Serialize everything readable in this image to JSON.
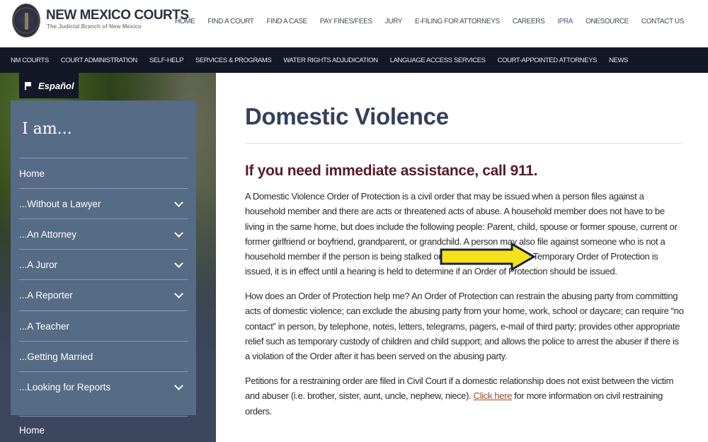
{
  "header": {
    "brand_title": "NEW MEXICO COURTS",
    "brand_subtitle": "The Judicial Branch of New Mexico",
    "top_nav": [
      {
        "label": "HOME"
      },
      {
        "label": "FIND A COURT"
      },
      {
        "label": "FIND A CASE"
      },
      {
        "label": "PAY FINES/FEES"
      },
      {
        "label": "JURY"
      },
      {
        "label": "E-FILING FOR ATTORNEYS"
      },
      {
        "label": "CAREERS"
      },
      {
        "label": "IPRA"
      },
      {
        "label": "ONESOURCE"
      },
      {
        "label": "CONTACT US"
      }
    ]
  },
  "main_nav": [
    {
      "label": "NM COURTS"
    },
    {
      "label": "COURT ADMINISTRATION"
    },
    {
      "label": "SELF-HELP"
    },
    {
      "label": "SERVICES & PROGRAMS"
    },
    {
      "label": "WATER RIGHTS ADJUDICATION"
    },
    {
      "label": "LANGUAGE ACCESS SERVICES"
    },
    {
      "label": "COURT-APPOINTED ATTORNEYS"
    },
    {
      "label": "NEWS"
    }
  ],
  "sidebar": {
    "language_label": "Español",
    "title": "I am...",
    "items": [
      {
        "label": "Home",
        "expandable": false
      },
      {
        "label": "...Without a Lawyer",
        "expandable": true
      },
      {
        "label": "...An Attorney",
        "expandable": true
      },
      {
        "label": "...A Juror",
        "expandable": true
      },
      {
        "label": "...A Reporter",
        "expandable": true
      },
      {
        "label": "...A Teacher",
        "expandable": false
      },
      {
        "label": "...Getting Married",
        "expandable": false
      },
      {
        "label": "...Looking for Reports",
        "expandable": true
      }
    ],
    "bottom_item": "Home"
  },
  "content": {
    "title": "Domestic Violence",
    "alert": "If you need immediate assistance, call 911.",
    "paragraph1": "A Domestic Violence Order of Protection is a civil order that may be issued when a person files against a household member and there are acts or threatened acts of abuse.  A household member does not have to be living in the same home, but does include the following people: Parent, child, spouse or former spouse, current or former girlfriend or boyfriend, grandparent, or grandchild.  A person may also file against someone who is not a household member if the person is being stalked or sexually assaulted.  If a Temporary Order of Protection is issued, it is in effect until a hearing is held to determine if an Order of Protection should be issued.",
    "paragraph2": "How does an Order of Protection help me?  An Order of Protection can restrain the abusing party from committing acts of domestic violence; can exclude the abusing party from your home, work, school or daycare; can require “no contact” in person, by telephone, notes, letters, telegrams, pagers, e-mail of third party; provides other appropriate relief such as temporary custody of children and child support; and allows the police to arrest the abuser if there is a violation of the Order after it has been served on the abusing party.",
    "paragraph3_before": "Petitions for a restraining order are filed in Civil Court if a domestic relationship does not exist between the victim and abuser (i.e. brother, sister, aunt, uncle, nephew, niece).  ",
    "paragraph3_link": "Click here",
    "paragraph3_after": " for more information on civil restraining orders."
  },
  "annotation": {
    "arrow_color": "#f5e21a",
    "arrow_outline": "#1a2340"
  }
}
